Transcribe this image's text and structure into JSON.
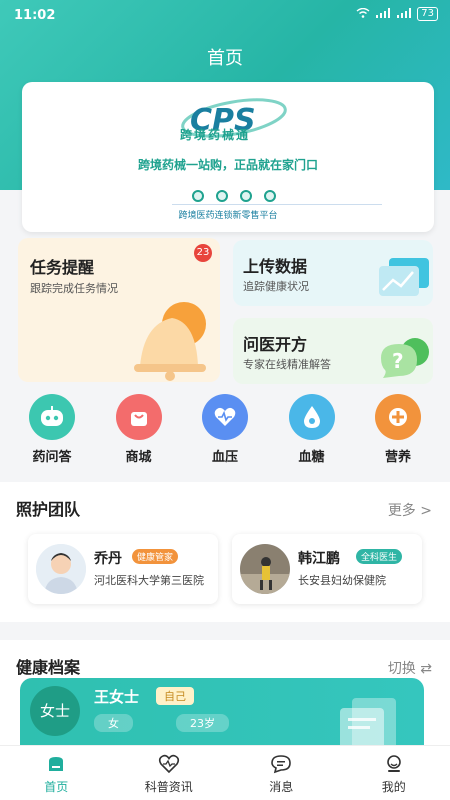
{
  "status_bar": {
    "time": "11:02",
    "battery": "73"
  },
  "page_title": "首页",
  "banner": {
    "logo": "CPS",
    "logo_text": "跨境药械通",
    "slogan": "跨境药械一站购，正品就在家门口",
    "subtitle": "跨境医药连锁新零售平台"
  },
  "cards": {
    "task": {
      "title": "任务提醒",
      "subtitle": "跟踪完成任务情况",
      "badge": "23"
    },
    "upload": {
      "title": "上传数据",
      "subtitle": "追踪健康状况"
    },
    "doctor": {
      "title": "问医开方",
      "subtitle": "专家在线精准解答"
    }
  },
  "quick_actions": [
    {
      "label": "药问答",
      "icon": "robot-icon",
      "color": "#3cc7b0"
    },
    {
      "label": "商城",
      "icon": "shopping-bag-icon",
      "color": "#f36c6c"
    },
    {
      "label": "血压",
      "icon": "heart-icon",
      "color": "#5a8ff2"
    },
    {
      "label": "血糖",
      "icon": "drop-icon",
      "color": "#4ab7e8"
    },
    {
      "label": "营养",
      "icon": "plus-icon",
      "color": "#f2933c"
    }
  ],
  "care_team": {
    "title": "照护团队",
    "more": "更多 >",
    "members": [
      {
        "name": "乔丹",
        "tag": "健康管家",
        "tag_color": "#f2933c",
        "org": "河北医科大学第三医院"
      },
      {
        "name": "韩江鹏",
        "tag": "全科医生",
        "tag_color": "#2fb5a5",
        "org": "长安县妇幼保健院"
      }
    ]
  },
  "health_records": {
    "title": "健康档案",
    "switch": "切换 ⇄",
    "profile": {
      "avatar_text": "女士",
      "name": "王女士",
      "role": "自己",
      "gender": "女",
      "age": "23岁"
    }
  },
  "tabs": [
    {
      "label": "首页",
      "icon": "home-icon",
      "active": true
    },
    {
      "label": "科普资讯",
      "icon": "heart-outline-icon",
      "active": false
    },
    {
      "label": "消息",
      "icon": "chat-icon",
      "active": false
    },
    {
      "label": "我的",
      "icon": "user-icon",
      "active": false
    }
  ]
}
